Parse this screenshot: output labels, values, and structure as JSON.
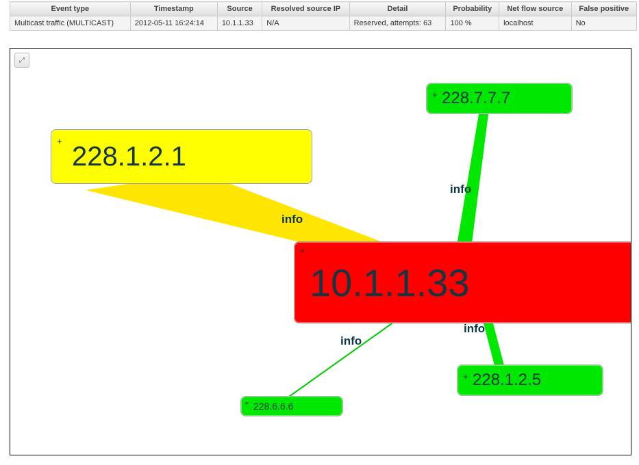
{
  "table": {
    "headers": [
      "Event type",
      "Timestamp",
      "Source",
      "Resolved source IP",
      "Detail",
      "Probability",
      "Net flow source",
      "False positive"
    ],
    "row": {
      "event_type": "Multicast traffic (MULTICAST)",
      "timestamp": "2012-05-11 16:24:14",
      "source": "10.1.1.33",
      "resolved_ip": "N/A",
      "detail": "Reserved, attempts: 63",
      "probability": "100 %",
      "netflow_source": "localhost",
      "false_positive": "No"
    }
  },
  "graph": {
    "expand_icon_title": "Expand",
    "edge_label": "info",
    "nodes": {
      "center": {
        "label": "10.1.1.33",
        "color": "red"
      },
      "nw": {
        "label": "228.1.2.1",
        "color": "yellow"
      },
      "ne": {
        "label": "228.7.7.7",
        "color": "green"
      },
      "se": {
        "label": "228.1.2.5",
        "color": "green"
      },
      "sw": {
        "label": "228.6.6.6",
        "color": "green"
      }
    },
    "edge_labels": {
      "nw": "info",
      "ne": "info",
      "se": "info",
      "sw": "info"
    }
  }
}
